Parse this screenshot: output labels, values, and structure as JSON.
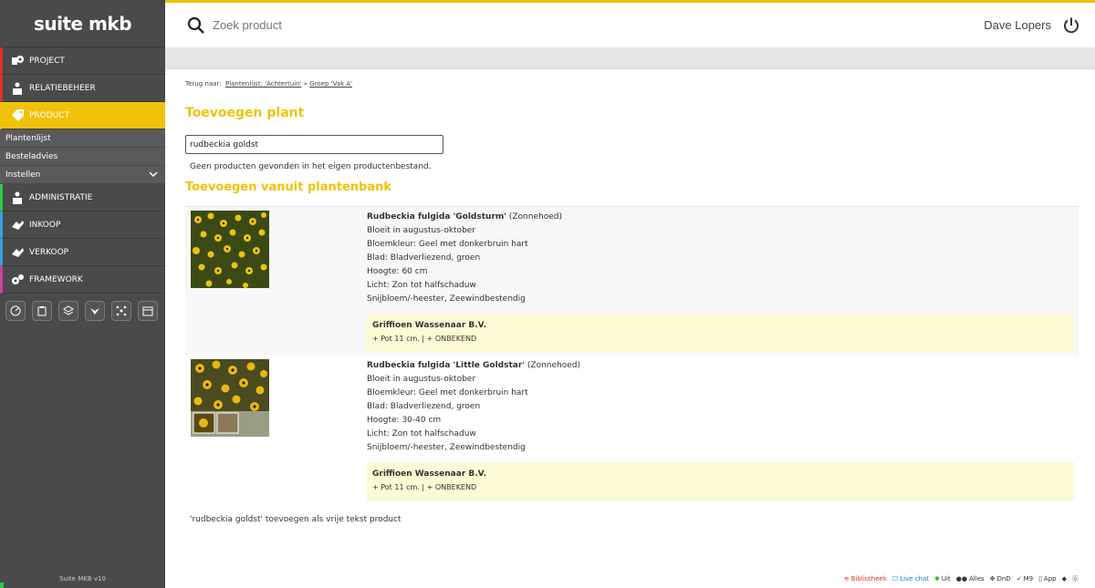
{
  "app": {
    "logo": "suite mkb",
    "version": "Suite MKB v10"
  },
  "sidebar": {
    "items": [
      {
        "label": "PROJECT",
        "color": "#e03030"
      },
      {
        "label": "RELATIEBEHEER",
        "color": "#e03030"
      },
      {
        "label": "PRODUCT",
        "color": "#f0c20a"
      },
      {
        "label": "ADMINISTRATIE",
        "color": "#2ecc40"
      },
      {
        "label": "INKOOP",
        "color": "#3aa0e0"
      },
      {
        "label": "VERKOOP",
        "color": "#3aa0e0"
      },
      {
        "label": "FRAMEWORK",
        "color": "#d040a0"
      }
    ],
    "sub": [
      "Plantenlijst",
      "Besteladvies",
      "Instellen"
    ]
  },
  "topbar": {
    "search_placeholder": "Zoek product",
    "user": "Dave Lopers"
  },
  "breadcrumb": {
    "prefix": "Terug naar:",
    "link1": "Plantenlijst: 'Achtertuin'",
    "sep": "»",
    "link2": "Groep 'Vak A'"
  },
  "main": {
    "title": "Toevoegen plant",
    "input_value": "rudbeckia goldst",
    "no_results": "Geen producten gevonden in het eigen productenbestand.",
    "subtitle": "Toevoegen vanuit plantenbank",
    "free_text": "'rudbeckia goldst' toevoegen als vrije tekst product"
  },
  "results": [
    {
      "name_bold": "Rudbeckia fulgida 'Goldsturm'",
      "name_rest": " (Zonnehoed)",
      "lines": [
        "Bloeit in augustus-oktober",
        "Bloemkleur: Geel met donkerbruin hart",
        "Blad: Bladverliezend, groen",
        "Hoogte: 60 cm",
        "Licht: Zon tot halfschaduw",
        "Snijbloem/-heester, Zeewindbestendig"
      ],
      "supplier": "Griffioen Wassenaar B.V.",
      "opt1": "Pot 11 cm.",
      "opt2": "ONBEKEND"
    },
    {
      "name_bold": "Rudbeckia fulgida 'Little Goldstar'",
      "name_rest": " (Zonnehoed)",
      "lines": [
        "Bloeit in augustus-oktober",
        "Bloemkleur: Geel met donkerbruin hart",
        "Blad: Bladverliezend, groen",
        "Hoogte: 30-40 cm",
        "Licht: Zon tot halfschaduw",
        "Snijbloem/-heester, Zeewindbestendig"
      ],
      "supplier": "Griffioen Wassenaar B.V.",
      "opt1": "Pot 11 cm.",
      "opt2": "ONBEKEND"
    }
  ],
  "footer": {
    "bibliotheek": "Bibliotheek",
    "livechat": "Live chat",
    "uit": "Uit",
    "alles": "Alles",
    "dnd": "DnD",
    "m9": "M9",
    "app": "App"
  }
}
